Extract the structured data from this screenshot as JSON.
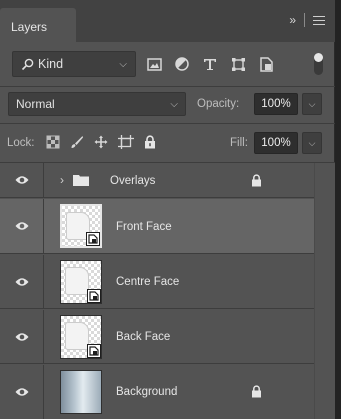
{
  "panel": {
    "tab_label": "Layers",
    "collapse_glyph": "»"
  },
  "filter": {
    "kind_label": "Kind",
    "icons": [
      "search-icon",
      "image-filter-icon",
      "adjustment-filter-icon",
      "type-filter-icon",
      "shape-filter-icon",
      "smart-object-filter-icon"
    ]
  },
  "blend": {
    "mode": "Normal",
    "opacity_label": "Opacity:",
    "opacity_value": "100%"
  },
  "lock": {
    "label": "Lock:",
    "fill_label": "Fill:",
    "fill_value": "100%"
  },
  "layers": [
    {
      "name": "Overlays",
      "type": "group",
      "locked": true,
      "selected": false
    },
    {
      "name": "Front Face",
      "type": "smart-object",
      "locked": false,
      "selected": true
    },
    {
      "name": "Centre Face",
      "type": "smart-object",
      "locked": false,
      "selected": false
    },
    {
      "name": "Back Face",
      "type": "smart-object",
      "locked": false,
      "selected": false
    },
    {
      "name": "Background",
      "type": "image",
      "locked": true,
      "selected": false
    }
  ],
  "colors": {
    "panel_bg": "#535353",
    "selected_row": "#656565",
    "tab_bar": "#424242"
  }
}
